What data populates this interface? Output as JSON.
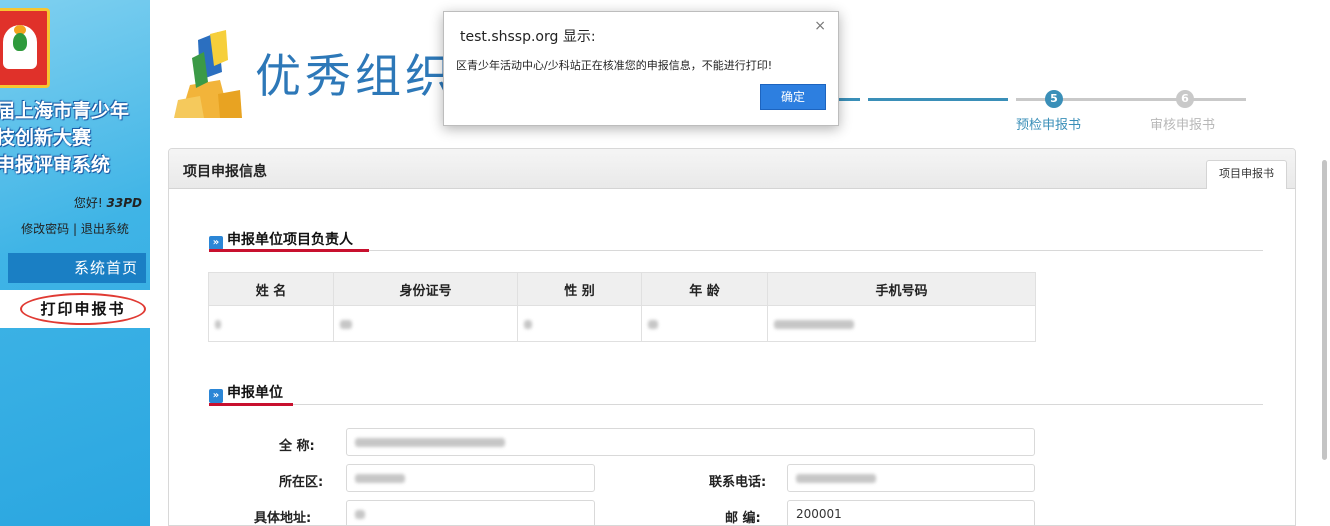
{
  "sidebar": {
    "title_lines": [
      "届上海市青少年",
      "技创新大赛",
      "申报评审系统"
    ],
    "greeting_prefix": "您好!",
    "username": "33PD",
    "change_password": "修改密码",
    "separator": "|",
    "logout": "退出系统",
    "home": "系统首页",
    "print": "打印申报书"
  },
  "header": {
    "title": "优秀组织",
    "steps": [
      {
        "num": "5",
        "label": "预检申报书",
        "state": "active"
      },
      {
        "num": "6",
        "label": "审核申报书",
        "state": "inactive"
      }
    ]
  },
  "panel": {
    "title": "项目申报信息",
    "tab": "项目申报书"
  },
  "section1": {
    "title": "申报单位项目负责人",
    "columns": [
      "姓 名",
      "身份证号",
      "性 别",
      "年 龄",
      "手机号码"
    ]
  },
  "section2": {
    "title": "申报单位",
    "full_name_label": "全 称:",
    "district_label": "所在区:",
    "phone_label": "联系电话:",
    "address_label": "具体地址:",
    "postcode_label": "邮 编:",
    "postcode_value": "200001"
  },
  "dialog": {
    "title": "test.shssp.org 显示:",
    "message": "区青少年活动中心/少科站正在核准您的申报信息，不能进行打印!",
    "ok": "确定",
    "close": "×"
  },
  "colors": {
    "accent": "#2b86d6",
    "underline": "#c8102e",
    "dialog_button": "#2d7fe0",
    "step_active": "#3a8fb8",
    "step_inactive": "#c9c9c9"
  }
}
